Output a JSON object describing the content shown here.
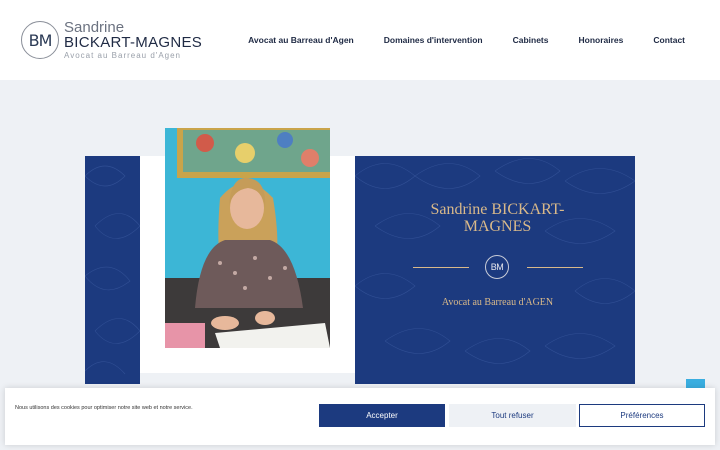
{
  "logo": {
    "monogram": "BM",
    "first_name": "Sandrine",
    "last_name": "BICKART-MAGNES",
    "tagline": "Avocat au Barreau d'Agen"
  },
  "nav": {
    "items": [
      {
        "label": "Avocat au Barreau d'Agen"
      },
      {
        "label": "Domaines d'intervention"
      },
      {
        "label": "Cabinets"
      },
      {
        "label": "Honoraires"
      },
      {
        "label": "Contact"
      }
    ]
  },
  "hero": {
    "name": "Sandrine BICKART-MAGNES",
    "badge": "BM",
    "subtitle": "Avocat au Barreau d'AGEN"
  },
  "cookie": {
    "text": "Nous utilisons des cookies pour optimiser notre site web et notre service.",
    "accept_label": "Accepter",
    "refuse_label": "Tout refuser",
    "prefs_label": "Préférences"
  },
  "colors": {
    "brand_blue": "#1c3a7f",
    "gold": "#d9b98a",
    "scroll_button": "#3aaee0"
  }
}
